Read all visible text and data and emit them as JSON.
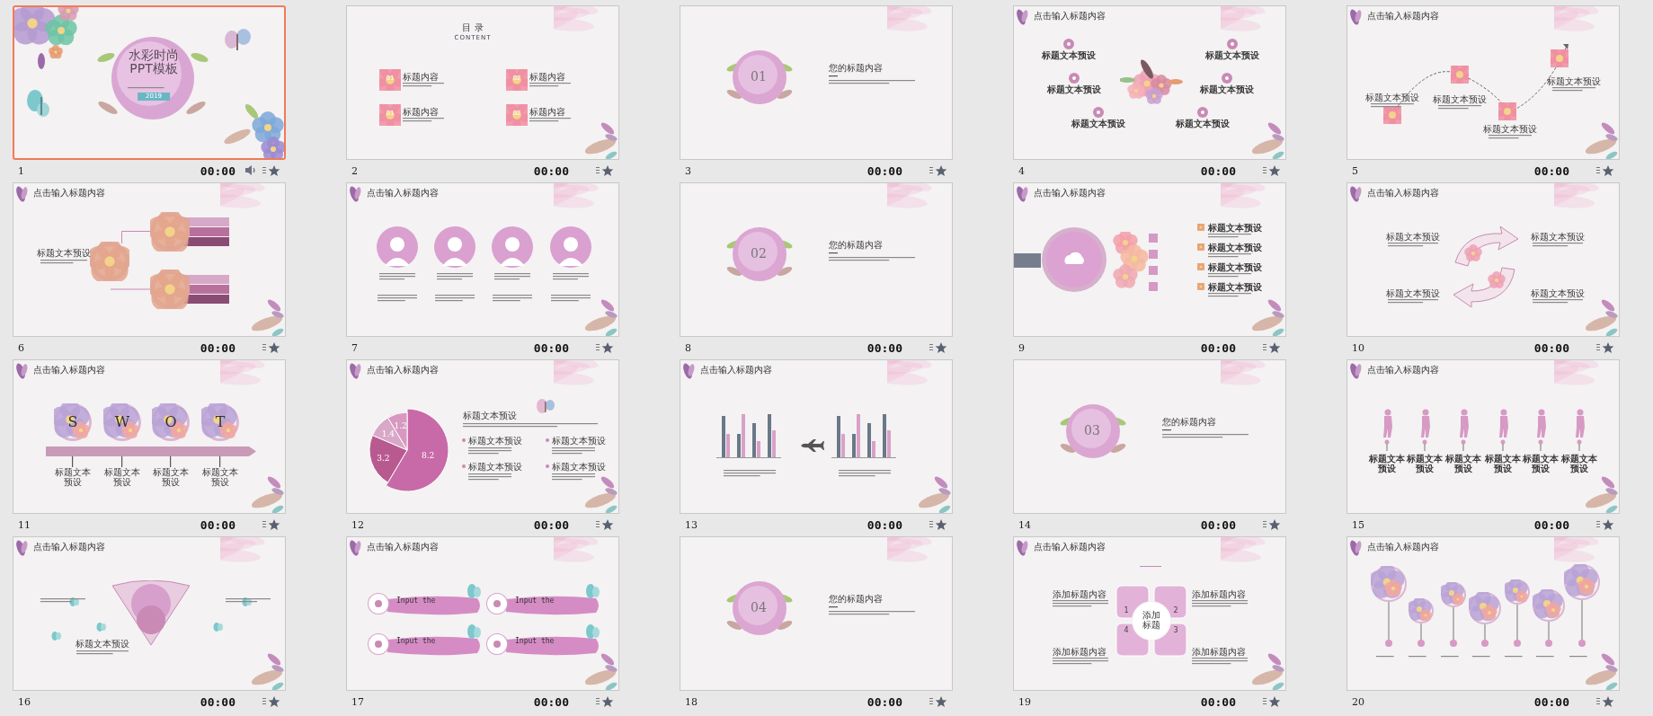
{
  "slides": [
    {
      "number": "1",
      "time": "00:00",
      "selected": true,
      "sound": true,
      "kind": "cover",
      "title_lines": [
        "水彩时尚",
        "PPT模板"
      ],
      "year": "2019"
    },
    {
      "number": "2",
      "time": "00:00",
      "selected": false,
      "sound": false,
      "kind": "contents",
      "title": "目 录",
      "subtitle": "CONTENT",
      "items": [
        {
          "number": "01",
          "label": "标题内容"
        },
        {
          "number": "02",
          "label": "标题内容"
        },
        {
          "number": "01",
          "label": "标题内容"
        },
        {
          "number": "02",
          "label": "标题内容"
        }
      ]
    },
    {
      "number": "3",
      "time": "00:00",
      "selected": false,
      "sound": false,
      "kind": "section",
      "badge": "01",
      "title": "您的标题内容"
    },
    {
      "number": "4",
      "time": "00:00",
      "selected": false,
      "sound": false,
      "kind": "bouquet",
      "header": "点击输入标题内容",
      "labels": [
        "标题文本预设",
        "标题文本预设",
        "标题文本预设",
        "标题文本预设",
        "标题文本预设",
        "标题文本预设"
      ]
    },
    {
      "number": "5",
      "time": "00:00",
      "selected": false,
      "sound": false,
      "kind": "path",
      "header": "点击输入标题内容",
      "labels": [
        "标题文本预设",
        "标题文本预设",
        "标题文本预设",
        "标题文本预设"
      ]
    },
    {
      "number": "6",
      "time": "00:00",
      "selected": false,
      "sound": false,
      "kind": "branches",
      "header": "点击输入标题内容",
      "labels": [
        "标题文本预设"
      ]
    },
    {
      "number": "7",
      "time": "00:00",
      "selected": false,
      "sound": false,
      "kind": "team",
      "header": "点击输入标题内容"
    },
    {
      "number": "8",
      "time": "00:00",
      "selected": false,
      "sound": false,
      "kind": "section",
      "badge": "02",
      "title": "您的标题内容"
    },
    {
      "number": "9",
      "time": "00:00",
      "selected": false,
      "sound": false,
      "kind": "magnifier",
      "header": "点击输入标题内容",
      "labels": [
        "标题文本预设",
        "标题文本预设",
        "标题文本预设",
        "标题文本预设"
      ]
    },
    {
      "number": "10",
      "time": "00:00",
      "selected": false,
      "sound": false,
      "kind": "cycle",
      "header": "点击输入标题内容",
      "labels": [
        "标题文本预设",
        "标题文本预设",
        "标题文本预设",
        "标题文本预设"
      ]
    },
    {
      "number": "11",
      "time": "00:00",
      "selected": false,
      "sound": false,
      "kind": "swot",
      "header": "点击输入标题内容",
      "letters": [
        "S",
        "W",
        "O",
        "T"
      ],
      "labels": [
        "标题文本预设",
        "标题文本预设",
        "标题文本预设",
        "标题文本预设"
      ]
    },
    {
      "number": "12",
      "time": "00:00",
      "selected": false,
      "sound": false,
      "kind": "pie",
      "header": "点击输入标题内容",
      "chart_title": "标题文本预设",
      "labels": [
        "标题文本预设",
        "标题文本预设",
        "标题文本预设",
        "标题文本预设"
      ],
      "chart_data": {
        "type": "pie",
        "values": [
          8.2,
          3.2,
          1.4,
          1.2
        ],
        "data_labels": true
      }
    },
    {
      "number": "13",
      "time": "00:00",
      "selected": false,
      "sound": false,
      "kind": "bars",
      "header": "点击输入标题内容"
    },
    {
      "number": "14",
      "time": "00:00",
      "selected": false,
      "sound": false,
      "kind": "section",
      "badge": "03",
      "title": "您的标题内容"
    },
    {
      "number": "15",
      "time": "00:00",
      "selected": false,
      "sound": false,
      "kind": "evolution",
      "header": "点击输入标题内容",
      "labels": [
        "标题文本预设",
        "标题文本预设",
        "标题文本预设",
        "标题文本预设",
        "标题文本预设",
        "标题文本预设"
      ]
    },
    {
      "number": "16",
      "time": "00:00",
      "selected": false,
      "sound": false,
      "kind": "fan",
      "header": "点击输入标题内容",
      "labels": [
        "标题文本预设"
      ]
    },
    {
      "number": "17",
      "time": "00:00",
      "selected": false,
      "sound": false,
      "kind": "pills",
      "header": "点击输入标题内容",
      "labels": [
        "Input the",
        "Input the",
        "Input the",
        "Input the"
      ]
    },
    {
      "number": "18",
      "time": "00:00",
      "selected": false,
      "sound": false,
      "kind": "section",
      "badge": "04",
      "title": "您的标题内容"
    },
    {
      "number": "19",
      "time": "00:00",
      "selected": false,
      "sound": false,
      "kind": "wheel",
      "header": "点击输入标题内容",
      "center_lines": [
        "添加",
        "标题"
      ],
      "numbers": [
        "1",
        "2",
        "4",
        "3"
      ],
      "labels": [
        "添加标题内容",
        "添加标题内容",
        "添加标题内容",
        "添加标题内容"
      ]
    },
    {
      "number": "20",
      "time": "00:00",
      "selected": false,
      "sound": false,
      "kind": "timeline",
      "header": "点击输入标题内容"
    }
  ]
}
